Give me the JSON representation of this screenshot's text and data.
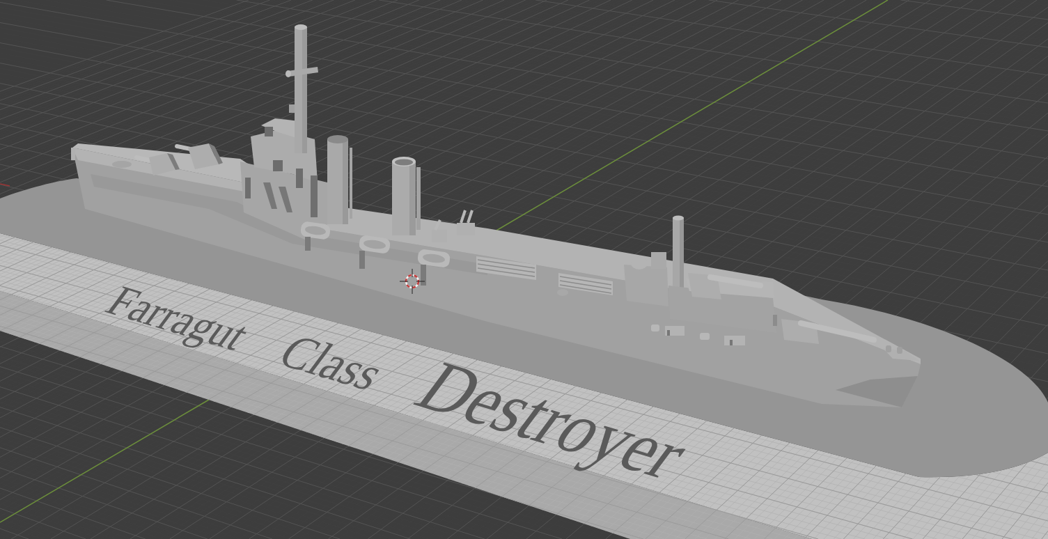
{
  "viewport": {
    "model_label": "Farragut Class Destroyer"
  }
}
